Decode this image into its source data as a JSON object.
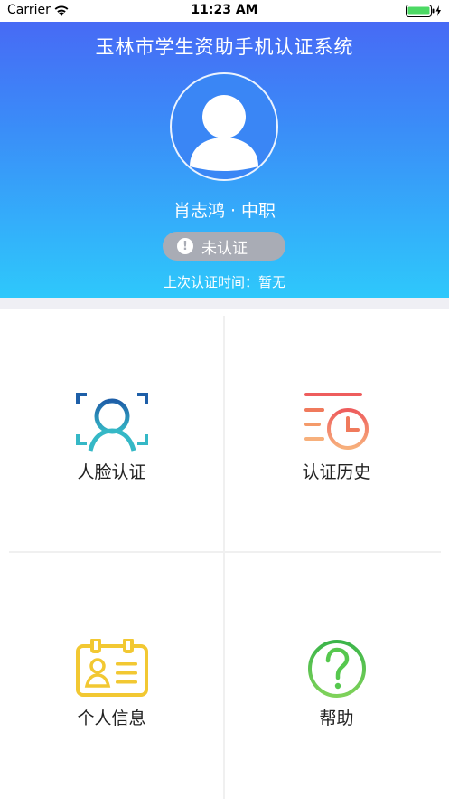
{
  "status_bar": {
    "carrier": "Carrier",
    "time": "11:23 AM",
    "wifi_icon": "wifi-icon",
    "battery_icon": "battery-charging-icon"
  },
  "header": {
    "title": "玉林市学生资助手机认证系统",
    "avatar_icon": "user-avatar-icon",
    "user_line": "肖志鸿 · 中职",
    "status_label": "未认证",
    "status_icon": "warning-icon",
    "last_auth": "上次认证时间：暂无"
  },
  "menu": {
    "face_auth": "人脸认证",
    "auth_history": "认证历史",
    "personal_info": "个人信息",
    "help": "帮助"
  },
  "colors": {
    "header_gradient_top": "#4a63f4",
    "header_gradient_bottom": "#2ec8fb",
    "pill_bg": "#a9acb5",
    "face_icon": "#1e7fb3",
    "history_icon": "#f07a5c",
    "info_icon": "#f2c832",
    "help_icon": "#56c84e"
  }
}
